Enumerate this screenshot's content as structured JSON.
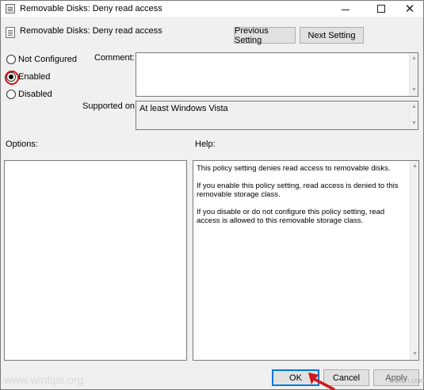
{
  "window": {
    "title": "Removable Disks: Deny read access",
    "minimize_glyph": "",
    "maximize_glyph": "",
    "close_glyph": "✕"
  },
  "header": {
    "title": "Removable Disks: Deny read access",
    "prev_label": "Previous Setting",
    "next_label": "Next Setting"
  },
  "state": {
    "options": [
      {
        "label": "Not Configured",
        "checked": false
      },
      {
        "label": "Enabled",
        "checked": true
      },
      {
        "label": "Disabled",
        "checked": false
      }
    ]
  },
  "comment": {
    "label": "Comment:",
    "value": ""
  },
  "supported": {
    "label": "Supported on:",
    "value": "At least Windows Vista"
  },
  "options_panel": {
    "label": "Options:"
  },
  "help_panel": {
    "label": "Help:",
    "paragraphs": [
      "This policy setting denies read access to removable disks.",
      "If you enable this policy setting, read access is denied to this removable storage class.",
      "If you disable or do not configure this policy setting, read access is allowed to this removable storage class."
    ]
  },
  "footer": {
    "ok_label": "OK",
    "cancel_label": "Cancel",
    "apply_label": "Apply"
  },
  "watermarks": {
    "left": "www.wintips.org",
    "right": "wsxdn.com"
  },
  "colors": {
    "highlight_ring": "#d01818",
    "arrow": "#d01818",
    "default_button_border": "#0078d7"
  }
}
